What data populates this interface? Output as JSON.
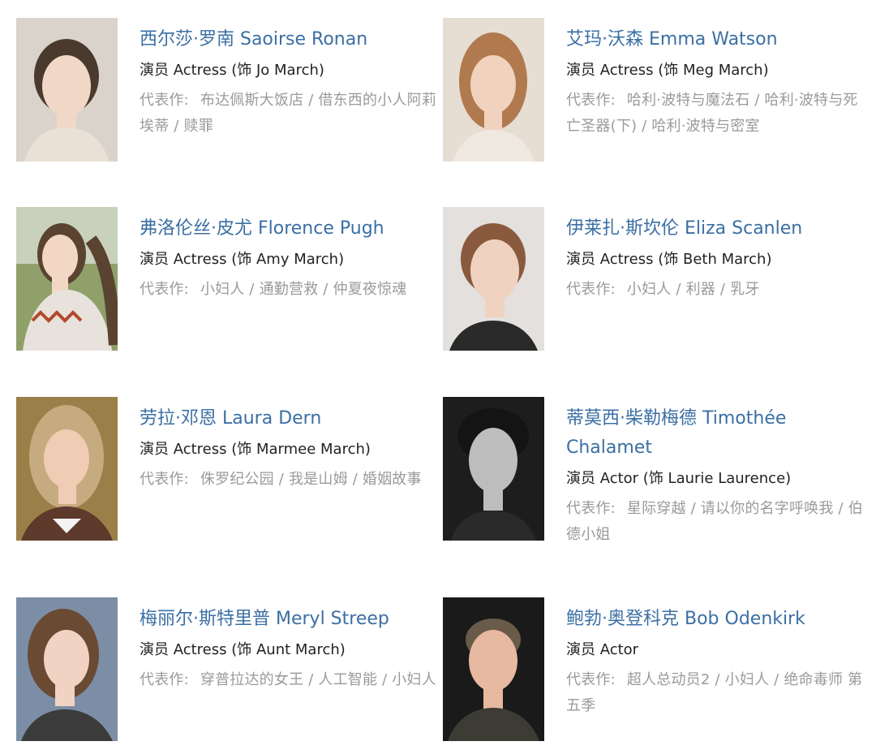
{
  "cast": [
    {
      "name": "西尔莎·罗南 Saoirse Ronan",
      "role": "演员 Actress (饰 Jo March)",
      "works_label": "代表作:",
      "works": "布达佩斯大饭店 / 借东西的小人阿莉埃蒂 / 赎罪",
      "photo": {
        "bg": "#d9d3cc",
        "hair": "#4a3a2e",
        "skin": "#f0d7c6",
        "shirt": "#e9e1d6"
      }
    },
    {
      "name": "艾玛·沃森 Emma Watson",
      "role": "演员 Actress (饰 Meg March)",
      "works_label": "代表作:",
      "works": "哈利·波特与魔法石 / 哈利·波特与死亡圣器(下) / 哈利·波特与密室",
      "photo": {
        "bg": "#e6ddd3",
        "hair": "#b07a4e",
        "skin": "#f1d2bf",
        "shirt": "#efe9e2"
      }
    },
    {
      "name": "弗洛伦丝·皮尤 Florence Pugh",
      "role": "演员 Actress (饰 Amy March)",
      "works_label": "代表作:",
      "works": "小妇人 / 通勤营救 / 仲夏夜惊魂",
      "photo": {
        "bg": "#8fa06a",
        "hair": "#5a4330",
        "skin": "#f2d7c5",
        "shirt": "#e8e2dc"
      }
    },
    {
      "name": "伊莱扎·斯坎伦 Eliza Scanlen",
      "role": "演员 Actress (饰 Beth March)",
      "works_label": "代表作:",
      "works": "小妇人 / 利器 / 乳牙",
      "photo": {
        "bg": "#e3e0dd",
        "hair": "#8a5a3e",
        "skin": "#f0d2c0",
        "shirt": "#2a2a2a"
      }
    },
    {
      "name": "劳拉·邓恩 Laura Dern",
      "role": "演员 Actress (饰 Marmee March)",
      "works_label": "代表作:",
      "works": "侏罗纪公园 / 我是山姆 / 婚姻故事",
      "photo": {
        "bg": "#9a7f48",
        "hair": "#c7ab80",
        "skin": "#f0ccb4",
        "shirt": "#5d3a2c"
      }
    },
    {
      "name": "蒂莫西·柴勒梅德 Timothée Chalamet",
      "role": "演员 Actor (饰 Laurie Laurence)",
      "works_label": "代表作:",
      "works": "星际穿越 / 请以你的名字呼唤我 / 伯德小姐",
      "photo": {
        "bg": "#1d1d1d",
        "hair": "#141414",
        "skin": "#bdbdbd",
        "shirt": "#2a2a2a"
      }
    },
    {
      "name": "梅丽尔·斯特里普 Meryl Streep",
      "role": "演员 Actress (饰 Aunt March)",
      "works_label": "代表作:",
      "works": "穿普拉达的女王 / 人工智能 / 小妇人",
      "photo": {
        "bg": "#7c8ea6",
        "hair": "#6a4a33",
        "skin": "#f0d3c2",
        "shirt": "#3b3b3b"
      }
    },
    {
      "name": "鲍勃·奥登科克 Bob Odenkirk",
      "role": "演员 Actor",
      "works_label": "代表作:",
      "works": "超人总动员2 / 小妇人 / 绝命毒师 第五季",
      "photo": {
        "bg": "#1a1a1a",
        "hair": "#6a5a4a",
        "skin": "#e6b9a0",
        "shirt": "#3c3b34"
      }
    }
  ]
}
